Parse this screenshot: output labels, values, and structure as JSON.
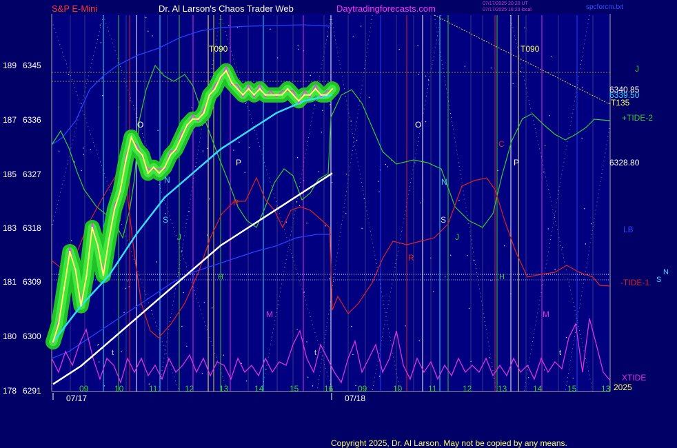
{
  "header": {
    "symbol": "S&P E-Mini",
    "title": "Dr. Al Larson's Chaos Trader Web",
    "site": "Daytradingforecasts.com",
    "stamp_line1": "07/17/2025 20:20 UT",
    "stamp_line2": "07/17/2025 16:20 local",
    "file": "spcforcm.txt"
  },
  "footer": {
    "copyright": "Copyright 2025, Dr. Al Larson. May not be copied by any means."
  },
  "colors": {
    "background": "#000066",
    "plot_bg": "#000080",
    "price": "#ffff66",
    "price_halo": "#22cc22",
    "cyan_avg": "#33ddff",
    "white_avg": "#ffffff",
    "tide2": "#33cc33",
    "tide1": "#dd2222",
    "xtide": "#dd33dd",
    "blue_band": "#2244ff",
    "level_line": "#888833"
  },
  "chart_data": {
    "type": "line",
    "title": "S&P E-Mini",
    "y_ranges": {
      "left_label_min": 178,
      "left_label_max": 189,
      "price_min": 6291,
      "price_max": 6345
    },
    "y_ticks_left": [
      "178",
      "180",
      "181",
      "183",
      "185",
      "187",
      "189"
    ],
    "y_ticks_price": [
      "6291",
      "6300",
      "6309",
      "6318",
      "6327",
      "6336",
      "6345"
    ],
    "x_hour_ticks_day1": [
      "09",
      "10",
      "11",
      "12",
      "13",
      "14",
      "15",
      "16"
    ],
    "x_hour_ticks_day2": [
      "09",
      "10",
      "11",
      "12",
      "13",
      "14",
      "15",
      "13"
    ],
    "date_labels": [
      "07/17",
      "07/18"
    ],
    "year_label": "2025",
    "right_labels": {
      "price_a": "6340.85",
      "price_b": "6339.50",
      "t135": "-T135",
      "price_c": "6328.80",
      "tide2": "+TIDE-2",
      "tide1": "-TIDE-1",
      "xtide": "XTIDE",
      "j": "J",
      "lb": "LB",
      "s": "S",
      "n": "N"
    },
    "annotations": [
      "T090",
      "T090",
      "O",
      "O",
      "N",
      "N",
      "S",
      "S",
      "J",
      "J",
      "P",
      "P",
      "R",
      "R",
      "C",
      "H",
      "H",
      "M",
      "M",
      "t",
      "t",
      "t"
    ],
    "series": [
      {
        "name": "Price",
        "x": [
          0,
          2,
          4,
          6,
          8,
          10,
          12,
          14,
          16,
          18,
          20,
          22,
          24,
          26,
          28,
          30,
          32,
          34,
          36,
          38,
          40,
          42,
          44,
          46,
          48,
          50,
          52,
          54,
          56,
          58,
          60,
          62,
          64,
          66,
          68,
          70,
          72,
          74,
          76,
          78,
          80,
          82,
          84,
          86,
          88,
          90,
          92,
          94,
          96,
          98,
          100
        ],
        "values": [
          6299,
          6302,
          6308,
          6314,
          6311,
          6305,
          6310,
          6318,
          6315,
          6310,
          6316,
          6321,
          6324,
          6329,
          6333,
          6331,
          6330,
          6327,
          6328,
          6327,
          6328,
          6330,
          6331,
          6333,
          6335,
          6336,
          6336,
          6337,
          6340,
          6341,
          6343,
          6344,
          6342,
          6341,
          6340,
          6341,
          6340,
          6341,
          6340,
          6340,
          6340,
          6340,
          6341,
          6340,
          6339,
          6340,
          6340,
          6341,
          6340,
          6340,
          6341
        ]
      },
      {
        "name": "Cyan average",
        "x": [
          0,
          10,
          20,
          30,
          40,
          50,
          60,
          70,
          80,
          90,
          100
        ],
        "values": [
          6299,
          6305,
          6310,
          6317,
          6323,
          6327,
          6331,
          6334,
          6337,
          6339,
          6340
        ]
      },
      {
        "name": "White average",
        "x": [
          0,
          10,
          20,
          30,
          40,
          50,
          60,
          70,
          80,
          90,
          100
        ],
        "values": [
          6292,
          6295,
          6299,
          6303,
          6307,
          6311,
          6315,
          6318,
          6321,
          6324,
          6327
        ]
      }
    ]
  }
}
